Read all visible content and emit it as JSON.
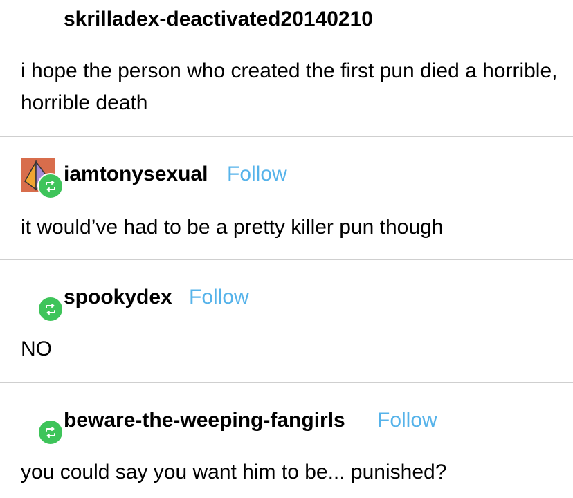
{
  "thread": {
    "original": {
      "username": "skrilladex-deactivated20140210",
      "text": "i hope the person who created the first pun died a horrible, horrible death"
    },
    "replies": [
      {
        "username": "iamtonysexual",
        "follow_label": "Follow",
        "text": "it would’ve had to be a pretty killer pun though",
        "icon": "reblog-icon"
      },
      {
        "username": "spookydex",
        "follow_label": "Follow",
        "text": "NO",
        "icon": "reblog-icon"
      },
      {
        "username": "beware-the-weeping-fangirls",
        "follow_label": "Follow",
        "text": "you could say you want him to be... punished?",
        "icon": "reblog-icon"
      }
    ]
  },
  "colors": {
    "follow": "#56b3ea",
    "reblog_badge": "#3ec45a",
    "divider": "#cfcfcf",
    "avatar_bg": "#d86d4c"
  }
}
